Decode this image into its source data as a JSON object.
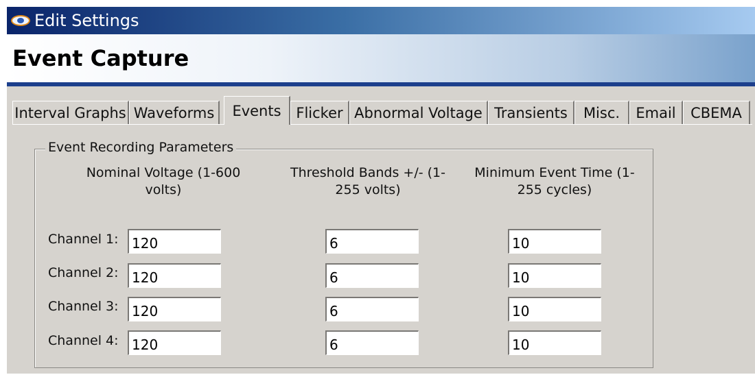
{
  "window": {
    "title": "Edit Settings",
    "icon": "app-eye-icon"
  },
  "header": {
    "title": "Event Capture"
  },
  "tabs": [
    {
      "label": "Interval Graphs",
      "active": false
    },
    {
      "label": "Waveforms",
      "active": false
    },
    {
      "label": "Events",
      "active": true
    },
    {
      "label": "Flicker",
      "active": false
    },
    {
      "label": "Abnormal Voltage",
      "active": false
    },
    {
      "label": "Transients",
      "active": false
    },
    {
      "label": "Misc.",
      "active": false
    },
    {
      "label": "Email",
      "active": false
    },
    {
      "label": "CBEMA",
      "active": false
    }
  ],
  "group": {
    "legend": "Event Recording Parameters",
    "columns": [
      {
        "line1": "Nominal Voltage (1-600",
        "line2": "volts)"
      },
      {
        "line1": "Threshold Bands +/- (1-",
        "line2": "255 volts)"
      },
      {
        "line1": "Minimum Event Time (1-",
        "line2": "255 cycles)"
      }
    ],
    "channels": [
      {
        "label": "Channel 1:",
        "nominal": "120",
        "threshold": "6",
        "min_time": "10"
      },
      {
        "label": "Channel 2:",
        "nominal": "120",
        "threshold": "6",
        "min_time": "10"
      },
      {
        "label": "Channel 3:",
        "nominal": "120",
        "threshold": "6",
        "min_time": "10"
      },
      {
        "label": "Channel 4:",
        "nominal": "120",
        "threshold": "6",
        "min_time": "10"
      }
    ]
  }
}
